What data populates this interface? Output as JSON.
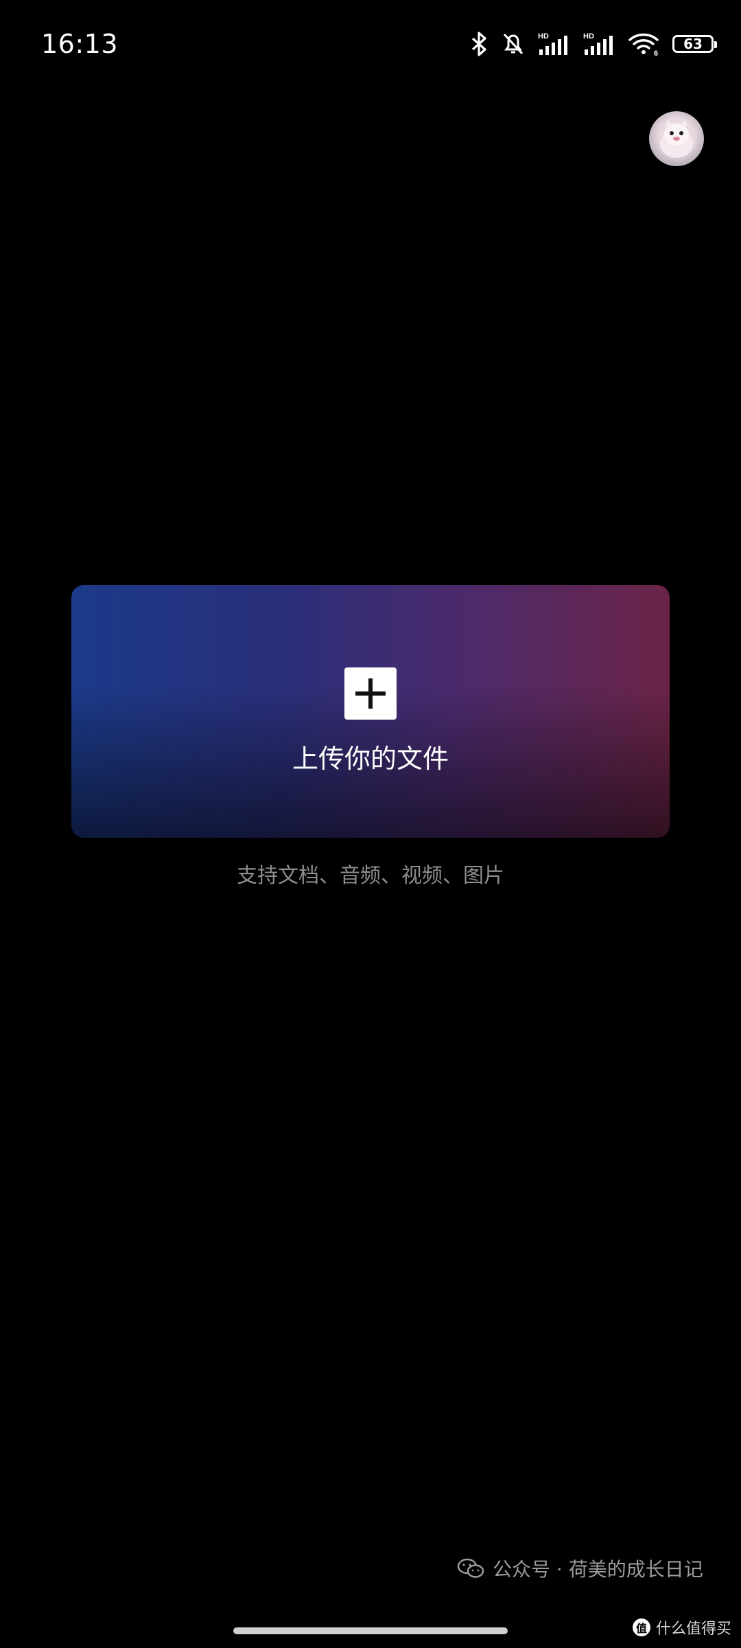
{
  "status_bar": {
    "time": "16:13",
    "battery_level": "63",
    "icons": [
      "bluetooth-icon",
      "mute-bell-icon",
      "signal-hd-icon",
      "signal-hd-icon",
      "wifi-icon",
      "battery-icon"
    ],
    "hd_label": "HD",
    "wifi_sub": "6"
  },
  "header": {
    "avatar_icon": "user-avatar"
  },
  "upload": {
    "label": "上传你的文件",
    "icon": "plus-icon",
    "support_text": "支持文档、音频、视频、图片",
    "gradient_colors": [
      "#1c3a8a",
      "#2a2f7a",
      "#4b2a6c",
      "#6b2447"
    ]
  },
  "watermark": {
    "text": "公众号 · 荷美的成长日记",
    "icon": "wechat-icon"
  },
  "corner_mark": {
    "text": "什么值得买"
  }
}
